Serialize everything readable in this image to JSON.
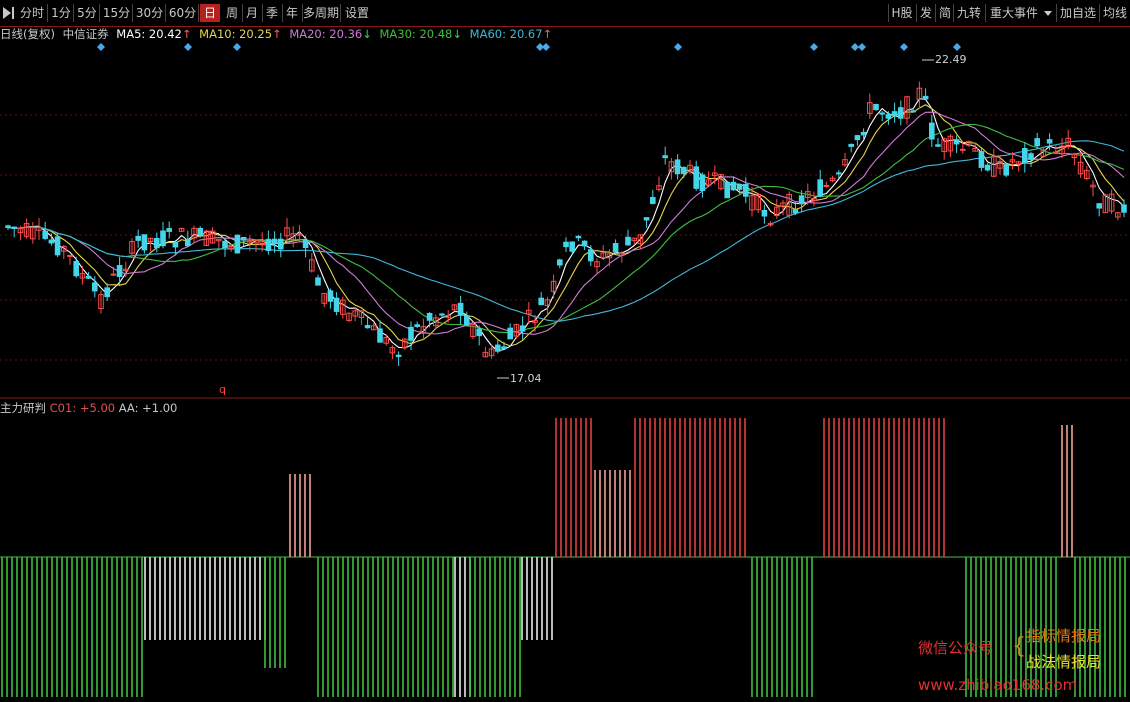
{
  "toolbar": {
    "periods": [
      "分时",
      "1分",
      "5分",
      "15分",
      "30分",
      "60分",
      "日",
      "周",
      "月",
      "季",
      "年",
      "多周期",
      "设置"
    ],
    "active": "日",
    "right": [
      "H股",
      "发",
      "简",
      "九转",
      "重大事件",
      "加自选",
      "均线"
    ]
  },
  "legend": {
    "period": "日线(复权)",
    "stock": "中信证券",
    "ma": [
      {
        "label": "MA5: 20.42",
        "arrow": "↑",
        "color": "#ffffff"
      },
      {
        "label": "MA10: 20.25",
        "arrow": "↑",
        "color": "#e8d44a"
      },
      {
        "label": "MA20: 20.36",
        "arrow": "↓",
        "color": "#d07ad8"
      },
      {
        "label": "MA30: 20.48",
        "arrow": "↓",
        "color": "#3fbf3f"
      },
      {
        "label": "MA60: 20.67",
        "arrow": "↑",
        "color": "#3fb8d8"
      }
    ]
  },
  "annotations": {
    "high": "22.49",
    "low": "17.04",
    "marker": "q"
  },
  "indicator": {
    "name": "主力研判",
    "c01": "C01: +5.00",
    "aa": "AA: +1.00"
  },
  "watermark": {
    "wechat": "微信公众号",
    "line1": "指标情报局",
    "line2": "战法情报局",
    "url": "www.zhibiao168.com"
  },
  "colors": {
    "up": "#ff4a4a",
    "down": "#44d6e8",
    "bg": "#000000",
    "accent": "#b8201e"
  }
}
